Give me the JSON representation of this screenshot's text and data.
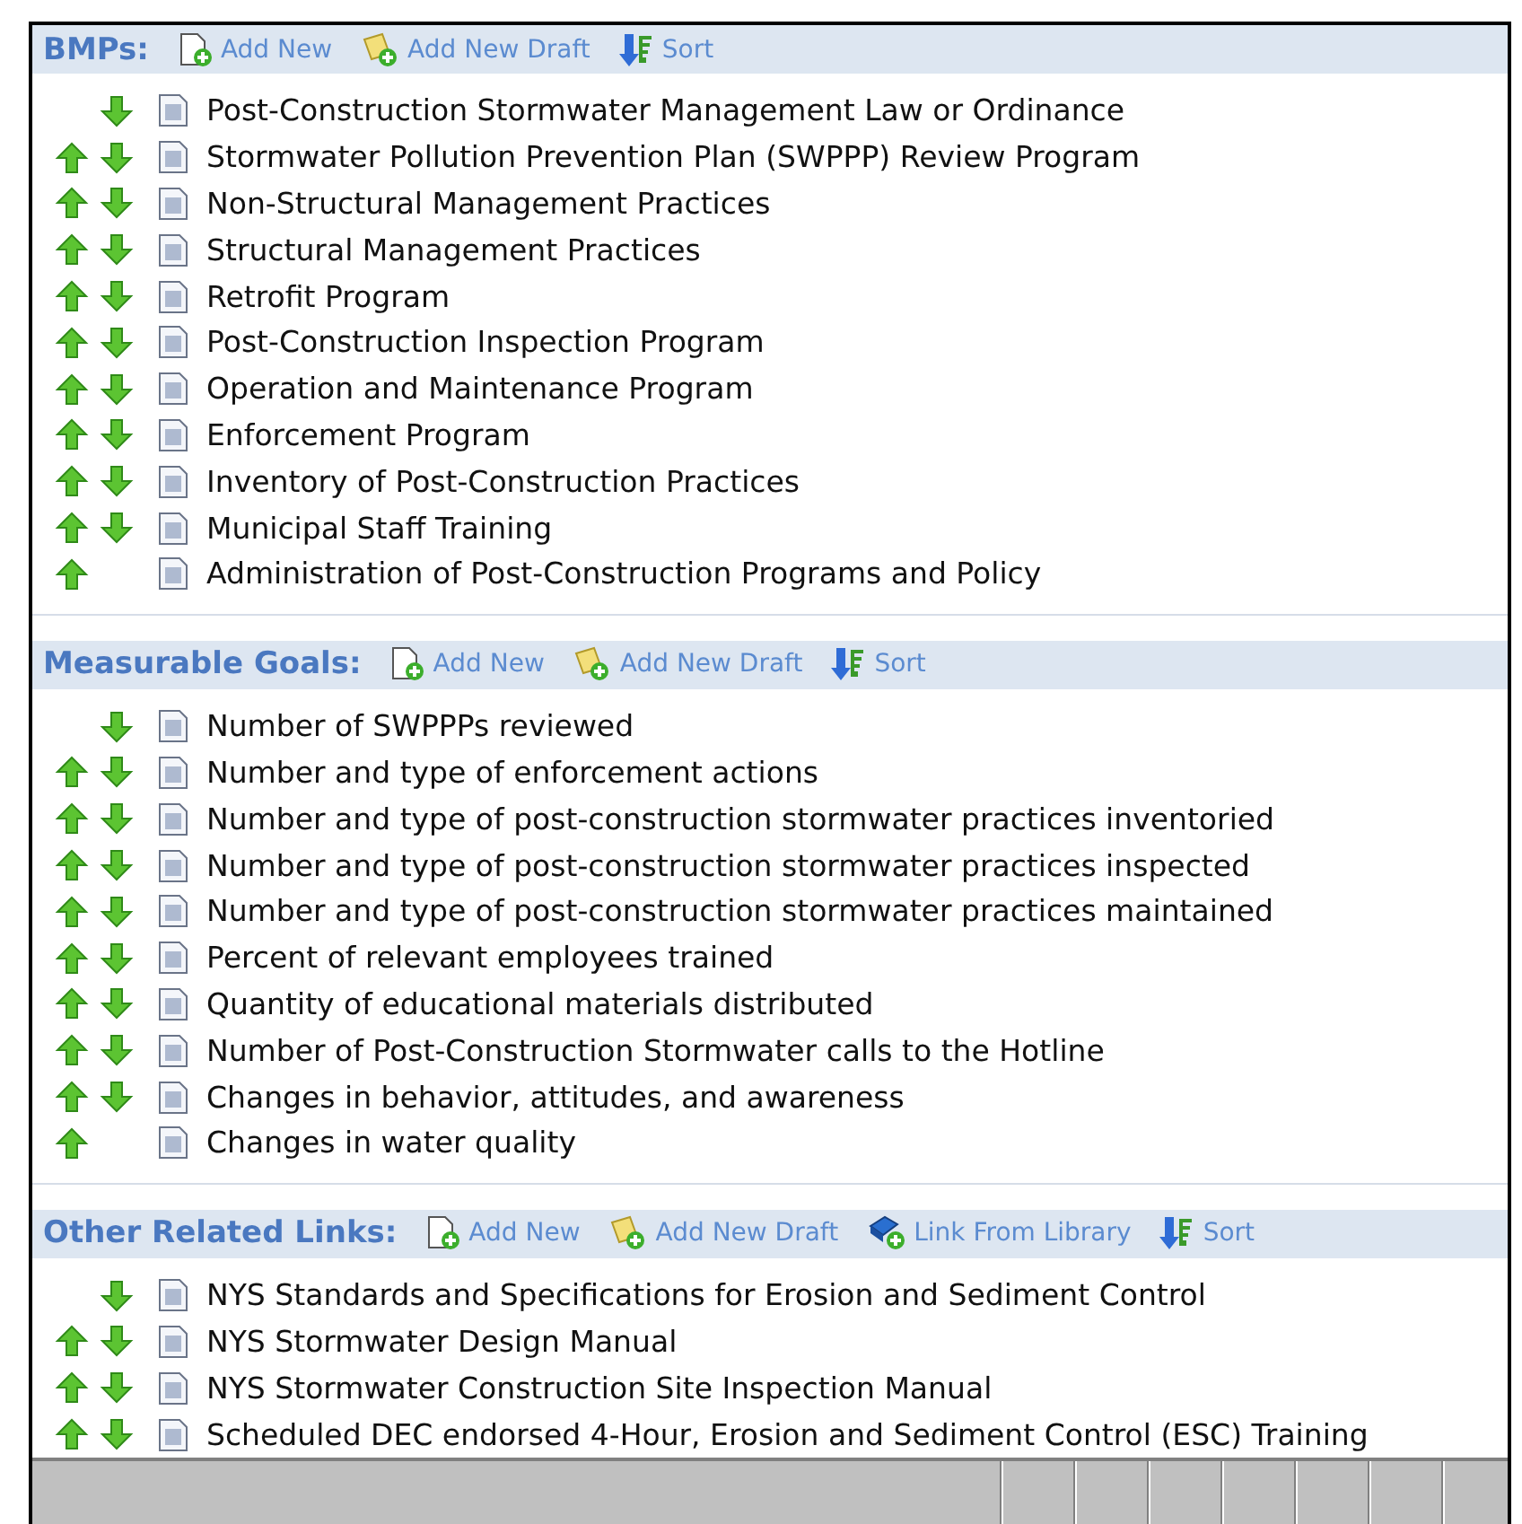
{
  "sections": [
    {
      "title": "BMPs:",
      "actions": [
        {
          "kind": "add",
          "label": "Add New"
        },
        {
          "kind": "draft",
          "label": "Add New Draft"
        },
        {
          "kind": "sort",
          "label": "Sort"
        }
      ],
      "items": [
        {
          "label": "Post-Construction Stormwater Management Law or Ordinance",
          "can_move_up": false,
          "can_move_down": true
        },
        {
          "label": "Stormwater Pollution Prevention Plan (SWPPP) Review Program",
          "can_move_up": true,
          "can_move_down": true
        },
        {
          "label": "Non-Structural Management Practices",
          "can_move_up": true,
          "can_move_down": true
        },
        {
          "label": "Structural Management Practices",
          "can_move_up": true,
          "can_move_down": true
        },
        {
          "label": "Retrofit Program",
          "can_move_up": true,
          "can_move_down": true
        },
        {
          "label": "Post-Construction Inspection Program",
          "can_move_up": true,
          "can_move_down": true
        },
        {
          "label": "Operation and Maintenance Program",
          "can_move_up": true,
          "can_move_down": true
        },
        {
          "label": "Enforcement Program",
          "can_move_up": true,
          "can_move_down": true
        },
        {
          "label": "Inventory of Post-Construction Practices",
          "can_move_up": true,
          "can_move_down": true
        },
        {
          "label": "Municipal Staff Training",
          "can_move_up": true,
          "can_move_down": true
        },
        {
          "label": "Administration of Post-Construction Programs and Policy",
          "can_move_up": true,
          "can_move_down": false
        }
      ]
    },
    {
      "title": "Measurable Goals:",
      "actions": [
        {
          "kind": "add",
          "label": "Add New"
        },
        {
          "kind": "draft",
          "label": "Add New Draft"
        },
        {
          "kind": "sort",
          "label": "Sort"
        }
      ],
      "items": [
        {
          "label": "Number of SWPPPs reviewed",
          "can_move_up": false,
          "can_move_down": true
        },
        {
          "label": "Number and type of enforcement actions",
          "can_move_up": true,
          "can_move_down": true
        },
        {
          "label": "Number and type of post-construction stormwater practices inventoried",
          "can_move_up": true,
          "can_move_down": true
        },
        {
          "label": "Number and type of post-construction stormwater practices inspected",
          "can_move_up": true,
          "can_move_down": true
        },
        {
          "label": "Number and type of post-construction stormwater practices maintained",
          "can_move_up": true,
          "can_move_down": true
        },
        {
          "label": "Percent of relevant employees trained",
          "can_move_up": true,
          "can_move_down": true
        },
        {
          "label": "Quantity of educational materials distributed",
          "can_move_up": true,
          "can_move_down": true
        },
        {
          "label": "Number of Post-Construction Stormwater calls to the Hotline",
          "can_move_up": true,
          "can_move_down": true
        },
        {
          "label": "Changes in behavior, attitudes, and awareness",
          "can_move_up": true,
          "can_move_down": true
        },
        {
          "label": "Changes in water quality",
          "can_move_up": true,
          "can_move_down": false
        }
      ]
    },
    {
      "title": "Other Related Links:",
      "actions": [
        {
          "kind": "add",
          "label": "Add New"
        },
        {
          "kind": "draft",
          "label": "Add New Draft"
        },
        {
          "kind": "library",
          "label": "Link From Library"
        },
        {
          "kind": "sort",
          "label": "Sort"
        }
      ],
      "items": [
        {
          "label": "NYS Standards and Specifications for Erosion and Sediment Control",
          "can_move_up": false,
          "can_move_down": true
        },
        {
          "label": "NYS Stormwater Design Manual",
          "can_move_up": true,
          "can_move_down": true
        },
        {
          "label": "NYS Stormwater Construction Site Inspection Manual",
          "can_move_up": true,
          "can_move_down": true
        },
        {
          "label": "Scheduled DEC endorsed 4-Hour, Erosion and Sediment Control (ESC) Training",
          "can_move_up": true,
          "can_move_down": true
        }
      ]
    }
  ]
}
